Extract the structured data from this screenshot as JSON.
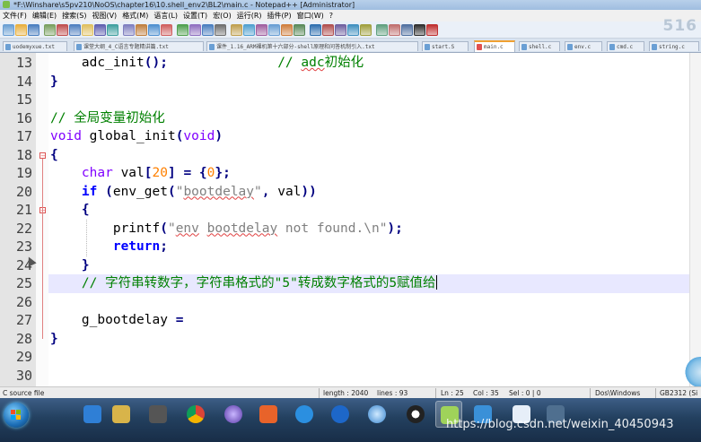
{
  "window": {
    "title": "*F:\\Winshare\\s5pv210\\NoOS\\chapter16\\10.shell_env2\\BL2\\main.c - Notepad++ [Administrator]"
  },
  "menu": [
    "文件(F)",
    "编辑(E)",
    "搜索(S)",
    "视图(V)",
    "格式(M)",
    "语言(L)",
    "设置(T)",
    "宏(O)",
    "运行(R)",
    "插件(P)",
    "窗口(W)",
    "?"
  ],
  "toolbar_logo": "516",
  "tabs": [
    {
      "label": "uodemyxue.txt",
      "active": false
    },
    {
      "label": "课堂大纲_4_C语言专题精讲篇.txt",
      "active": false
    },
    {
      "label": "课件_1.16_ARM裸机第十六部分-shell原理和问答机制引入.txt",
      "active": false
    },
    {
      "label": "start.S",
      "active": false
    },
    {
      "label": "main.c",
      "active": true
    },
    {
      "label": "shell.c",
      "active": false
    },
    {
      "label": "env.c",
      "active": false
    },
    {
      "label": "cmd.c",
      "active": false
    },
    {
      "label": "string.c",
      "active": false
    }
  ],
  "code_lines": [
    {
      "num": "13",
      "text": "    adc_init();              // adc初始化"
    },
    {
      "num": "14",
      "text": "}"
    },
    {
      "num": "15",
      "text": ""
    },
    {
      "num": "16",
      "text": "// 全局变量初始化"
    },
    {
      "num": "17",
      "text": "void global_init(void)"
    },
    {
      "num": "18",
      "text": "{"
    },
    {
      "num": "19",
      "text": "    char val[20] = {0};"
    },
    {
      "num": "20",
      "text": "    if (env_get(\"bootdelay\", val))"
    },
    {
      "num": "21",
      "text": "    {"
    },
    {
      "num": "22",
      "text": "        printf(\"env bootdelay not found.\\n\");"
    },
    {
      "num": "23",
      "text": "        return;"
    },
    {
      "num": "24",
      "text": "    }"
    },
    {
      "num": "25",
      "text": "    // 字符串转数字，字符串格式的\"5\"转成数字格式的5赋值给"
    },
    {
      "num": "26",
      "text": ""
    },
    {
      "num": "27",
      "text": "    g_bootdelay ="
    },
    {
      "num": "28",
      "text": "}"
    },
    {
      "num": "29",
      "text": ""
    },
    {
      "num": "30",
      "text": ""
    }
  ],
  "syntax_colors": {
    "comment": "#008000",
    "keyword": "#0000ff",
    "type": "#8000ff",
    "number": "#ff8000",
    "string": "#808080",
    "operator": "#000080",
    "current_line_bg": "#e8e8ff"
  },
  "status": {
    "file_type": "C source file",
    "length": "length : 2040",
    "lines": "lines : 93",
    "ln": "Ln : 25",
    "col": "Col : 35",
    "sel": "Sel : 0 | 0",
    "eol": "Dos\\Windows",
    "encoding": "GB2312 (Si"
  },
  "taskbar": {
    "buttons": [
      "start-orb",
      "qq-browser",
      "file-explorer",
      "video-recorder",
      "chrome",
      "media-player",
      "pdf-reader",
      "cloud-sync",
      "k-app",
      "network",
      "qq",
      "notepad-plus-plus",
      "task-app",
      "doc-viewer",
      "devtool"
    ]
  },
  "watermark": "https://blog.csdn.net/weixin_40450943"
}
